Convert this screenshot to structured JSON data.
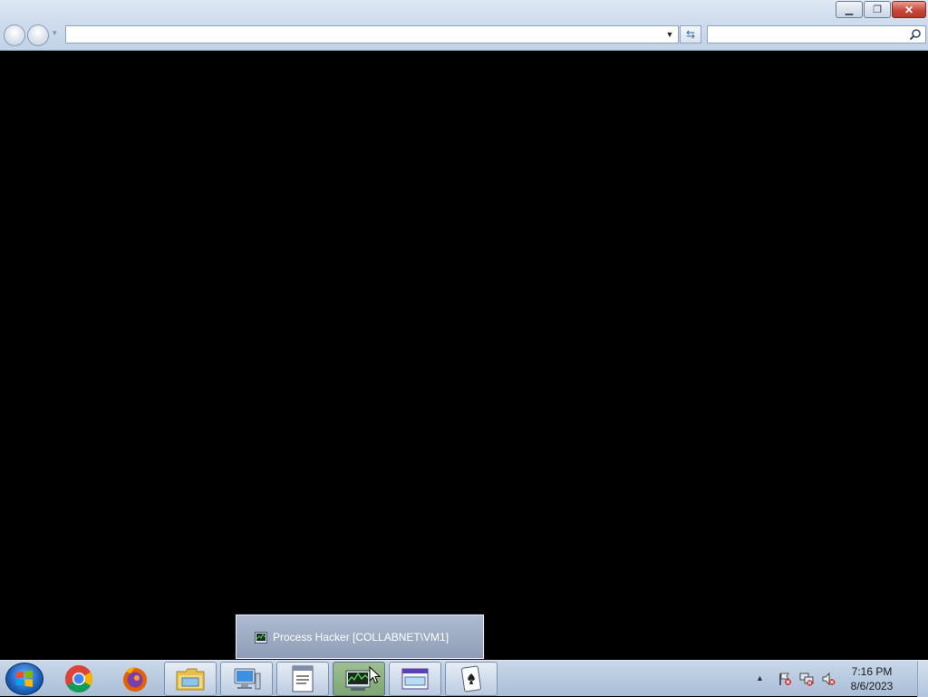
{
  "window": {
    "address_value": "",
    "search_value": ""
  },
  "taskbar": {
    "pinned": [
      {
        "name": "chrome-icon",
        "open": false
      },
      {
        "name": "firefox-icon",
        "open": false
      },
      {
        "name": "file-explorer-icon",
        "open": true
      },
      {
        "name": "computer-icon",
        "open": true
      },
      {
        "name": "notepad-icon",
        "open": true
      },
      {
        "name": "process-hacker-icon",
        "open": true,
        "active": true
      },
      {
        "name": "window-app-icon",
        "open": true
      },
      {
        "name": "solitaire-icon",
        "open": true
      }
    ],
    "popup_label": "Process Hacker [COLLABNET\\VM1]",
    "clock_time": "7:16 PM",
    "clock_date": "8/6/2023"
  }
}
